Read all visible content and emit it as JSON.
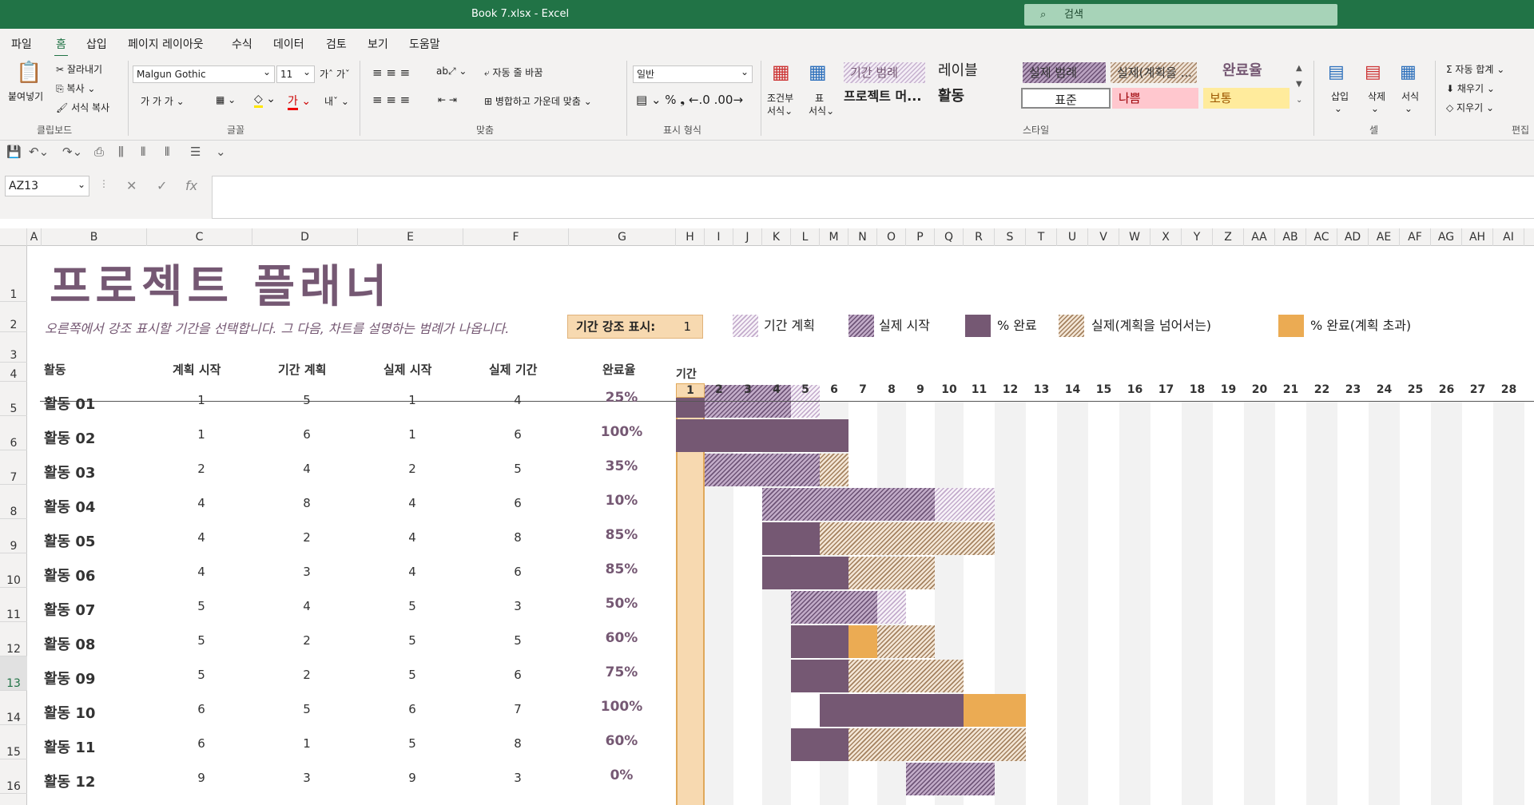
{
  "window": {
    "title": "Book 7.xlsx  -  Excel",
    "search_placeholder": "검색"
  },
  "menu": [
    "파일",
    "홈",
    "삽입",
    "페이지 레이아웃",
    "수식",
    "데이터",
    "검토",
    "보기",
    "도움말"
  ],
  "ribbon": {
    "clipboard": {
      "paste": "붙여넣기",
      "cut": "잘라내기",
      "copy": "복사",
      "format_painter": "서식 복사",
      "group": "클립보드"
    },
    "font": {
      "name": "Malgun Gothic",
      "size": "11",
      "group": "글꼴"
    },
    "align": {
      "wrap": "자동 줄 바꿈",
      "merge": "병합하고 가운데 맞춤",
      "group": "맞춤"
    },
    "number": {
      "format": "일반",
      "group": "표시 형식"
    },
    "styles": {
      "cond": "조건부",
      "cond2": "서식",
      "table": "표",
      "table2": "서식",
      "group": "스타일",
      "cells": [
        "기간 범례",
        "레이블",
        "실제 범례",
        "실제(계획을 ...",
        "완료율",
        "프로젝트 머...",
        "활동",
        "표준",
        "나쁨",
        "보통"
      ]
    },
    "cells": {
      "insert": "삽입",
      "delete": "삭제",
      "format": "서식",
      "group": "셀"
    },
    "edit": {
      "autosum": "자동 합계",
      "fill": "채우기",
      "clear": "지우기",
      "group": "편집"
    }
  },
  "namebox": "AZ13",
  "columns": [
    "A",
    "B",
    "C",
    "D",
    "E",
    "F",
    "G",
    "H",
    "I",
    "J",
    "K",
    "L",
    "M",
    "N",
    "O",
    "P",
    "Q",
    "R",
    "S",
    "T",
    "U",
    "V",
    "W",
    "X",
    "Y",
    "Z",
    "AA",
    "AB",
    "AC",
    "AD",
    "AE",
    "AF",
    "AG",
    "AH",
    "AI"
  ],
  "rows": [
    "1",
    "2",
    "3",
    "4",
    "5",
    "6",
    "7",
    "8",
    "9",
    "10",
    "11",
    "12",
    "13",
    "14",
    "15",
    "16"
  ],
  "sheet": {
    "title": "프로젝트 플래너",
    "subtitle": "오른쪽에서 강조 표시할 기간을 선택합니다.  그 다음, 차트를 설명하는 범례가 나옵니다.",
    "highlight_label": "기간 강조 표시:",
    "highlight_value": "1",
    "legend": [
      "기간 계획",
      "실제 시작",
      "% 완료",
      "실제(계획을 넘어서는)",
      "% 완료(계획 초과)"
    ],
    "headers": [
      "활동",
      "계획 시작",
      "기간 계획",
      "실제 시작",
      "실제 기간",
      "완료율",
      "기간"
    ],
    "periods": [
      "1",
      "2",
      "3",
      "4",
      "5",
      "6",
      "7",
      "8",
      "9",
      "10",
      "11",
      "12",
      "13",
      "14",
      "15",
      "16",
      "17",
      "18",
      "19",
      "20",
      "21",
      "22",
      "23",
      "24",
      "25",
      "26",
      "27",
      "28"
    ],
    "activities": [
      {
        "name": "활동 01",
        "plan_start": 1,
        "plan_dur": 5,
        "act_start": 1,
        "act_dur": 4,
        "pct": "25%",
        "pct_val": 0.25
      },
      {
        "name": "활동 02",
        "plan_start": 1,
        "plan_dur": 6,
        "act_start": 1,
        "act_dur": 6,
        "pct": "100%",
        "pct_val": 1.0
      },
      {
        "name": "활동 03",
        "plan_start": 2,
        "plan_dur": 4,
        "act_start": 2,
        "act_dur": 5,
        "pct": "35%",
        "pct_val": 0.35
      },
      {
        "name": "활동 04",
        "plan_start": 4,
        "plan_dur": 8,
        "act_start": 4,
        "act_dur": 6,
        "pct": "10%",
        "pct_val": 0.1
      },
      {
        "name": "활동 05",
        "plan_start": 4,
        "plan_dur": 2,
        "act_start": 4,
        "act_dur": 8,
        "pct": "85%",
        "pct_val": 0.85
      },
      {
        "name": "활동 06",
        "plan_start": 4,
        "plan_dur": 3,
        "act_start": 4,
        "act_dur": 6,
        "pct": "85%",
        "pct_val": 0.85
      },
      {
        "name": "활동 07",
        "plan_start": 5,
        "plan_dur": 4,
        "act_start": 5,
        "act_dur": 3,
        "pct": "50%",
        "pct_val": 0.5
      },
      {
        "name": "활동 08",
        "plan_start": 5,
        "plan_dur": 2,
        "act_start": 5,
        "act_dur": 5,
        "pct": "60%",
        "pct_val": 0.6
      },
      {
        "name": "활동 09",
        "plan_start": 5,
        "plan_dur": 2,
        "act_start": 5,
        "act_dur": 6,
        "pct": "75%",
        "pct_val": 0.75
      },
      {
        "name": "활동 10",
        "plan_start": 6,
        "plan_dur": 5,
        "act_start": 6,
        "act_dur": 7,
        "pct": "100%",
        "pct_val": 1.0
      },
      {
        "name": "활동 11",
        "plan_start": 6,
        "plan_dur": 1,
        "act_start": 5,
        "act_dur": 8,
        "pct": "60%",
        "pct_val": 0.6
      },
      {
        "name": "활동 12",
        "plan_start": 9,
        "plan_dur": 3,
        "act_start": 9,
        "act_dur": 3,
        "pct": "0%",
        "pct_val": 0.0
      }
    ]
  },
  "colors": {
    "accent": "#217346",
    "title": "#755873",
    "done": "#755873",
    "over": "#ebab53",
    "highlight": "#f7d9b0"
  }
}
